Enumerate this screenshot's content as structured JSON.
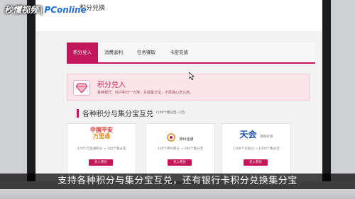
{
  "watermark": {
    "logo_left": "秒懂视频",
    "logo_right": "PConline"
  },
  "page": {
    "title": "积分兑换"
  },
  "tabs": [
    {
      "label": "积分兑入",
      "active": true
    },
    {
      "label": "消费返利",
      "active": false
    },
    {
      "label": "任务赚取",
      "active": false
    },
    {
      "label": "卡密充值",
      "active": false
    }
  ],
  "banner": {
    "title": "积分兑入",
    "subtitle": "各种银行、商户积分一大堆，兑成集分宝，不再操心怎么用。",
    "icon": "diamond-icon"
  },
  "section": {
    "title": "各种积分与集分宝互兑",
    "note": "(100个集分宝=1元)"
  },
  "cards": [
    {
      "brand_line1": "中国平安",
      "brand_line2": "万里通",
      "rate": "370个万里通积分 → 100个集分宝",
      "button": "兑入积分"
    },
    {
      "brand_line1": "神州运通",
      "brand_line2": "",
      "rate": "100个神州积分 → 100个集分宝",
      "button": "兑入积分"
    },
    {
      "brand_line1": "天会",
      "brand_line2": "网络有限",
      "rate": "1100个天会分 → 1000个集分宝",
      "button": "兑入积分"
    }
  ],
  "caption": "支持各种积分与集分宝互兑，还有银行卡积分兑换集分宝",
  "colors": {
    "accent": "#c2185b",
    "banner_bg": "#fbe4e9"
  }
}
